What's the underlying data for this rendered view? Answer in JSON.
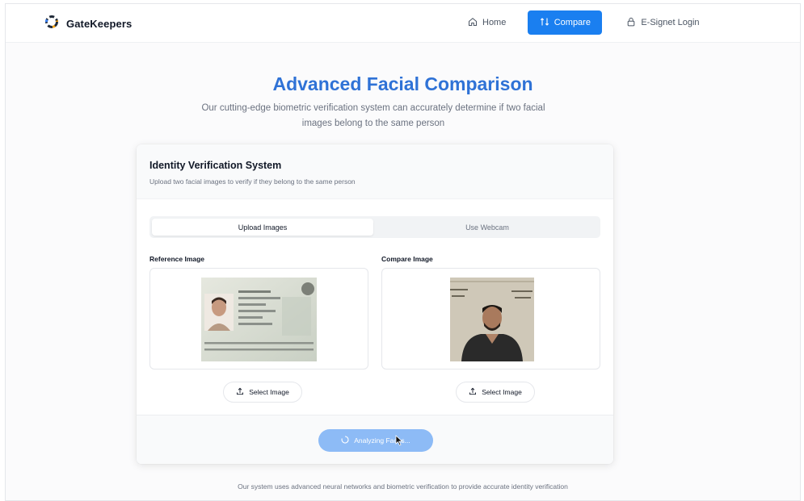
{
  "header": {
    "brand": "GateKeepers",
    "nav": [
      {
        "label": "Home",
        "icon": "home-icon"
      },
      {
        "label": "Compare",
        "icon": "compare-arrows-icon",
        "active": true
      },
      {
        "label": "E-Signet Login",
        "icon": "lock-icon"
      }
    ]
  },
  "hero": {
    "title": "Advanced Facial Comparison",
    "subtitle": "Our cutting-edge biometric verification system can accurately determine if two facial images belong to the same person"
  },
  "card": {
    "title": "Identity Verification System",
    "description": "Upload two facial images to verify if they belong to the same person",
    "tabs": [
      {
        "label": "Upload Images",
        "active": true
      },
      {
        "label": "Use Webcam",
        "active": false
      }
    ],
    "reference": {
      "label": "Reference Image",
      "button": "Select Image"
    },
    "compare": {
      "label": "Compare Image",
      "button": "Select Image"
    },
    "analyze_button": "Analyzing Faces..."
  },
  "footer_note": "Our system uses advanced neural networks and biometric verification to provide accurate identity verification",
  "colors": {
    "accent": "#1a7ff0",
    "title": "#2f72d6",
    "analyze_disabled": "#8dbbf6"
  }
}
